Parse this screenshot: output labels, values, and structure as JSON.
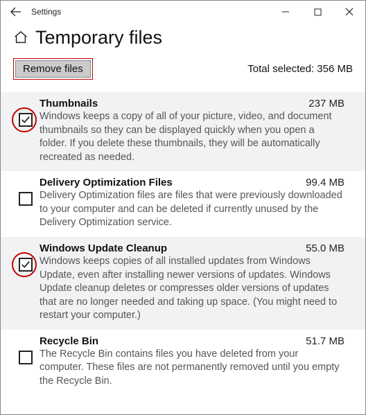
{
  "window": {
    "title": "Settings"
  },
  "page": {
    "title": "Temporary files",
    "remove_label": "Remove files",
    "total_label": "Total selected: 356 MB"
  },
  "items": [
    {
      "title": "Thumbnails",
      "size": "237 MB",
      "desc": "Windows keeps a copy of all of your picture, video, and document thumbnails so they can be displayed quickly when you open a folder. If you delete these thumbnails, they will be automatically recreated as needed.",
      "checked": true,
      "highlight": true
    },
    {
      "title": "Delivery Optimization Files",
      "size": "99.4 MB",
      "desc": "Delivery Optimization files are files that were previously downloaded to your computer and can be deleted if currently unused by the Delivery Optimization service.",
      "checked": false,
      "highlight": false
    },
    {
      "title": "Windows Update Cleanup",
      "size": "55.0 MB",
      "desc": "Windows keeps copies of all installed updates from Windows Update, even after installing newer versions of updates. Windows Update cleanup deletes or compresses older versions of updates that are no longer needed and taking up space. (You might need to restart your computer.)",
      "checked": true,
      "highlight": true
    },
    {
      "title": "Recycle Bin",
      "size": "51.7 MB",
      "desc": "The Recycle Bin contains files you have deleted from your computer. These files are not permanently removed until you empty the Recycle Bin.",
      "checked": false,
      "highlight": false
    }
  ]
}
